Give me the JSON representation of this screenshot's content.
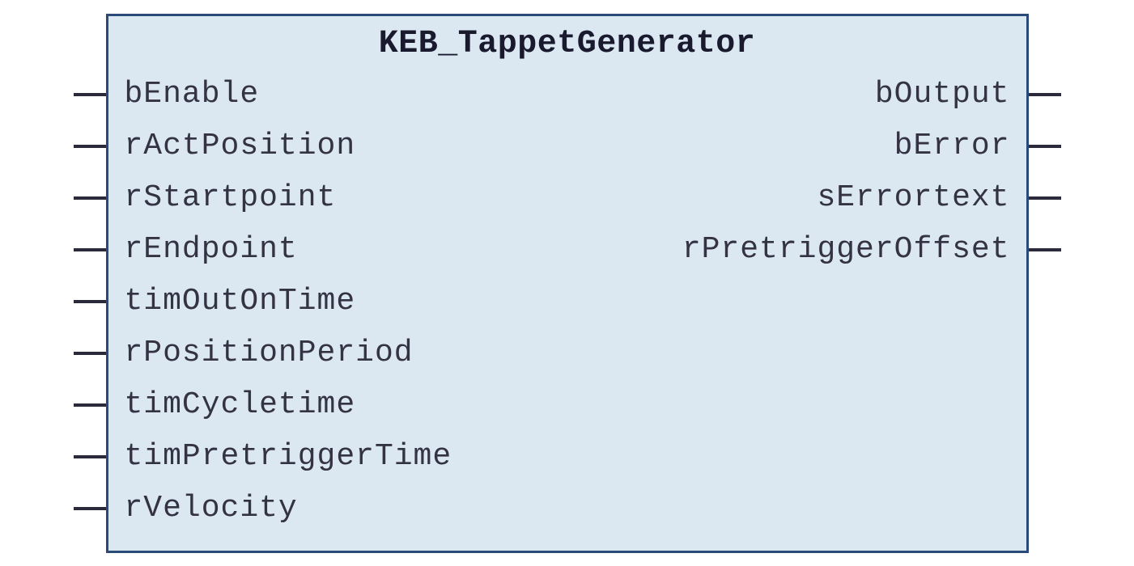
{
  "block": {
    "title": "KEB_TappetGenerator",
    "inputs": [
      "bEnable",
      "rActPosition",
      "rStartpoint",
      "rEndpoint",
      "timOutOnTime",
      "rPositionPeriod",
      "timCycletime",
      "timPretriggerTime",
      "rVelocity"
    ],
    "outputs": [
      "bOutput",
      "bError",
      "sErrortext",
      "rPretriggerOffset"
    ]
  }
}
